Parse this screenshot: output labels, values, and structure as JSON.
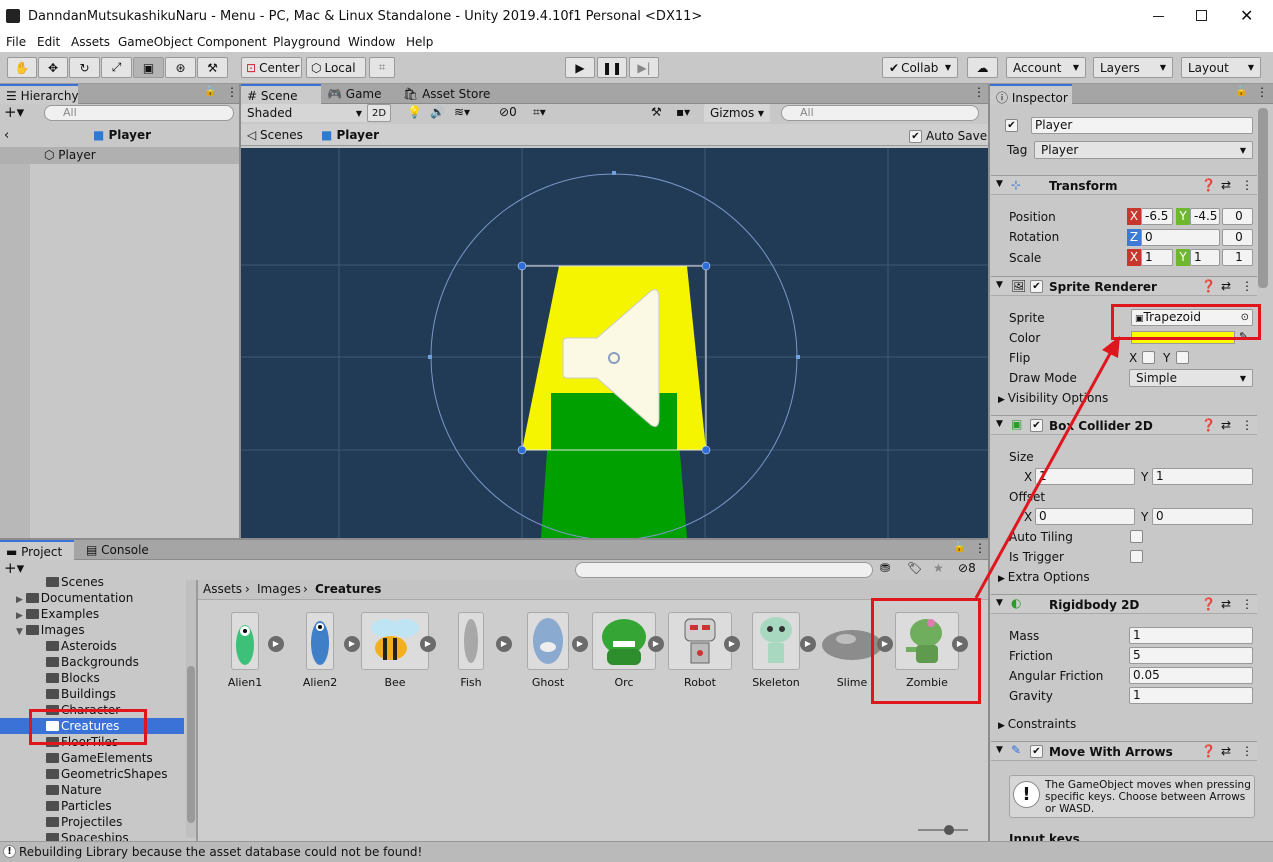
{
  "window": {
    "title": "DanndanMutsukashikuNaru - Menu - PC, Mac & Linux Standalone - Unity 2019.4.10f1 Personal <DX11>"
  },
  "menu": [
    "File",
    "Edit",
    "Assets",
    "GameObject",
    "Component",
    "Playground",
    "Window",
    "Help"
  ],
  "toolbar": {
    "center": "Center",
    "local": "Local",
    "collab": "Collab",
    "account": "Account",
    "layers": "Layers",
    "layout": "Layout"
  },
  "hierarchy": {
    "tab": "Hierarchy",
    "search_placeholder": "All",
    "breadcrumb": "Player",
    "item": "Player"
  },
  "scene": {
    "tabs": [
      "Scene",
      "Game",
      "Asset Store"
    ],
    "shaded": "Shaded",
    "mode2d": "2D",
    "hidden_count": "0",
    "gizmos": "Gizmos",
    "search_placeholder": "All",
    "bc_scenes": "Scenes",
    "bc_player": "Player",
    "autosave": "Auto Save"
  },
  "inspector": {
    "tab": "Inspector",
    "name": "Player",
    "tag_label": "Tag",
    "tag": "Player",
    "transform": {
      "title": "Transform",
      "position_label": "Position",
      "rotation_label": "Rotation",
      "scale_label": "Scale",
      "pos_x": "-6.5",
      "pos_y": "-4.5",
      "pos_z": "0",
      "rot_z": "0",
      "rot_extra": "0",
      "scale_x": "1",
      "scale_y": "1",
      "scale_z": "1"
    },
    "sprite_renderer": {
      "title": "Sprite Renderer",
      "sprite_label": "Sprite",
      "sprite": "Trapezoid",
      "color_label": "Color",
      "color": "#fffa00",
      "flip_label": "Flip",
      "draw_mode_label": "Draw Mode",
      "draw_mode": "Simple",
      "visibility": "Visibility Options"
    },
    "box_collider": {
      "title": "Box Collider 2D",
      "size_label": "Size",
      "offset_label": "Offset",
      "size_x": "1",
      "size_y": "1",
      "off_x": "0",
      "off_y": "0",
      "auto_tiling": "Auto Tiling",
      "is_trigger": "Is Trigger",
      "extra": "Extra Options"
    },
    "rigidbody": {
      "title": "Rigidbody 2D",
      "mass_label": "Mass",
      "mass": "1",
      "friction_label": "Friction",
      "friction": "5",
      "ang_label": "Angular Friction",
      "ang": "0.05",
      "gravity_label": "Gravity",
      "gravity": "1",
      "constraints": "Constraints"
    },
    "move": {
      "title": "Move With Arrows",
      "info": "The GameObject moves when pressing specific keys. Choose between Arrows or WASD.",
      "input_keys": "Input keys"
    },
    "axis_x": "X",
    "axis_y": "Y",
    "axis_z": "Z"
  },
  "project": {
    "tabs": [
      "Project",
      "Console"
    ],
    "tree": [
      "Scenes",
      "Documentation",
      "Examples",
      "Images",
      "Asteroids",
      "Backgrounds",
      "Blocks",
      "Buildings",
      "Character",
      "Creatures",
      "FloorTiles",
      "GameElements",
      "GeometricShapes",
      "Nature",
      "Particles",
      "Projectiles",
      "Spaceships"
    ],
    "breadcrumb": [
      "Assets",
      "Images",
      "Creatures"
    ],
    "hidden_count": "8",
    "assets": [
      "Alien1",
      "Alien2",
      "Bee",
      "Fish",
      "Ghost",
      "Orc",
      "Robot",
      "Skeleton",
      "Slime",
      "Zombie"
    ]
  },
  "status": "Rebuilding Library because the asset database could not be found!",
  "colors": {
    "accent": "#3a72d8",
    "highlight": "#e0161e",
    "scene_bg": "#213a56",
    "yellow": "#f5f500",
    "green": "#00a000"
  }
}
